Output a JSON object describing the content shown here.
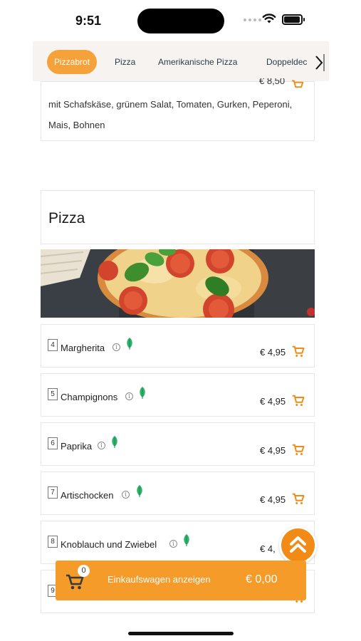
{
  "status": {
    "time": "9:51"
  },
  "tabs": [
    {
      "label": "Pizzabrot",
      "active": true
    },
    {
      "label": "Pizza",
      "active": false
    },
    {
      "label": "Amerikanische Pizza",
      "active": false
    },
    {
      "label": "Doppeldec",
      "active": false
    }
  ],
  "previous_item": {
    "price": "€ 8,50",
    "description_line1": "mit Schafskäse, grünem Salat, Tomaten, Gurken, Peperoni,",
    "description_line2": "Mais, Bohnen"
  },
  "section": {
    "title": "Pizza"
  },
  "items": [
    {
      "num": "4",
      "name": "Margherita",
      "price": "€ 4,95"
    },
    {
      "num": "5",
      "name": "Champignons",
      "price": "€ 4,95"
    },
    {
      "num": "6",
      "name": "Paprika",
      "price": "€ 4,95"
    },
    {
      "num": "7",
      "name": "Artischocken",
      "price": "€ 4,95"
    },
    {
      "num": "8",
      "name": "Knoblauch und Zwiebel",
      "price": "€ 4,"
    },
    {
      "num": "9",
      "name": "",
      "price": ""
    }
  ],
  "info_symbol": "i",
  "cart_bar": {
    "count": "0",
    "label": "Einkaufswagen anzeigen",
    "total": "€ 0,00"
  },
  "colors": {
    "accent": "#f5a23b",
    "cart_bar": "#f59b2a",
    "leaf": "#2fb36b",
    "tab_bar_bg": "#f6f3f0"
  },
  "icons": {
    "cart": "shopping-cart-icon",
    "vegetarian": "leaf-icon",
    "info": "info-icon",
    "scroll_top": "double-chevron-up-icon",
    "tabs_next": "chevron-right-icon"
  }
}
